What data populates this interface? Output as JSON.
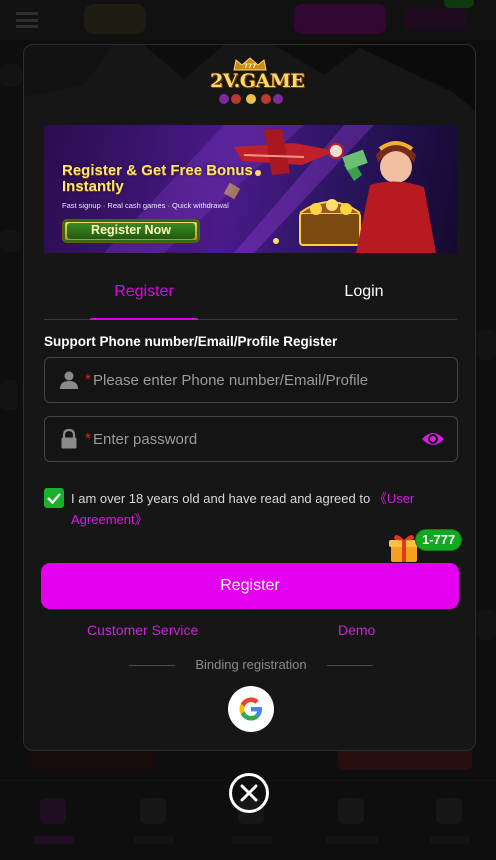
{
  "logo": {
    "text": "2V.GAME",
    "crown_text": "777"
  },
  "banner": {
    "title": "Register & Get Free Bonus Instantly",
    "subtitle": "Fast signup · Real cash games · Quick withdrawal",
    "cta": "Register Now"
  },
  "tabs": [
    {
      "label": "Register",
      "active": true
    },
    {
      "label": "Login",
      "active": false
    }
  ],
  "form": {
    "support_label": "Support Phone number/Email/Profile Register",
    "phone": {
      "required_mark": "*",
      "placeholder": "Please enter Phone number/Email/Profile",
      "value": ""
    },
    "password": {
      "required_mark": "*",
      "placeholder": "Enter password",
      "value": ""
    },
    "agreement": {
      "checked": true,
      "text": "I am over 18 years old and have read and agreed to ",
      "link": "《User Agreement》"
    },
    "register_button": "Register"
  },
  "promo": {
    "badge": "1-777"
  },
  "links": {
    "customer_service": "Customer Service",
    "demo": "Demo"
  },
  "divider": {
    "text": "Binding registration"
  },
  "social": {
    "google_icon": "google-icon"
  },
  "colors": {
    "accent": "#e200ee",
    "link": "#d21ede",
    "checkbox": "#16b02a",
    "required": "#e02020",
    "modal_bg": "#161616"
  }
}
